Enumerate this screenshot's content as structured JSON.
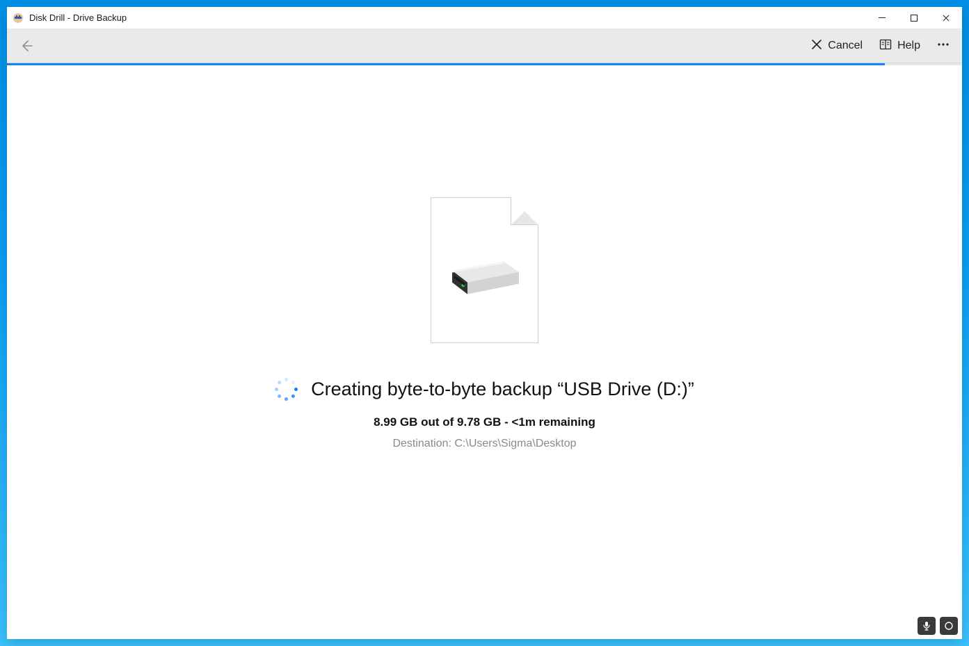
{
  "window": {
    "title": "Disk Drill - Drive Backup"
  },
  "toolbar": {
    "cancel_label": "Cancel",
    "help_label": "Help"
  },
  "progress": {
    "percent": 91.9
  },
  "main": {
    "status_title": "Creating byte-to-byte backup “USB Drive (D:)”",
    "stats_done": "8.99 GB",
    "stats_total": "9.78 GB",
    "stats_remaining": "<1m remaining",
    "stats_line": "8.99 GB out of 9.78 GB - <1m remaining",
    "destination_label": "Destination:",
    "destination_path": "C:\\Users\\Sigma\\Desktop",
    "destination_line": "Destination: C:\\Users\\Sigma\\Desktop"
  },
  "colors": {
    "accent": "#0b84ff"
  }
}
